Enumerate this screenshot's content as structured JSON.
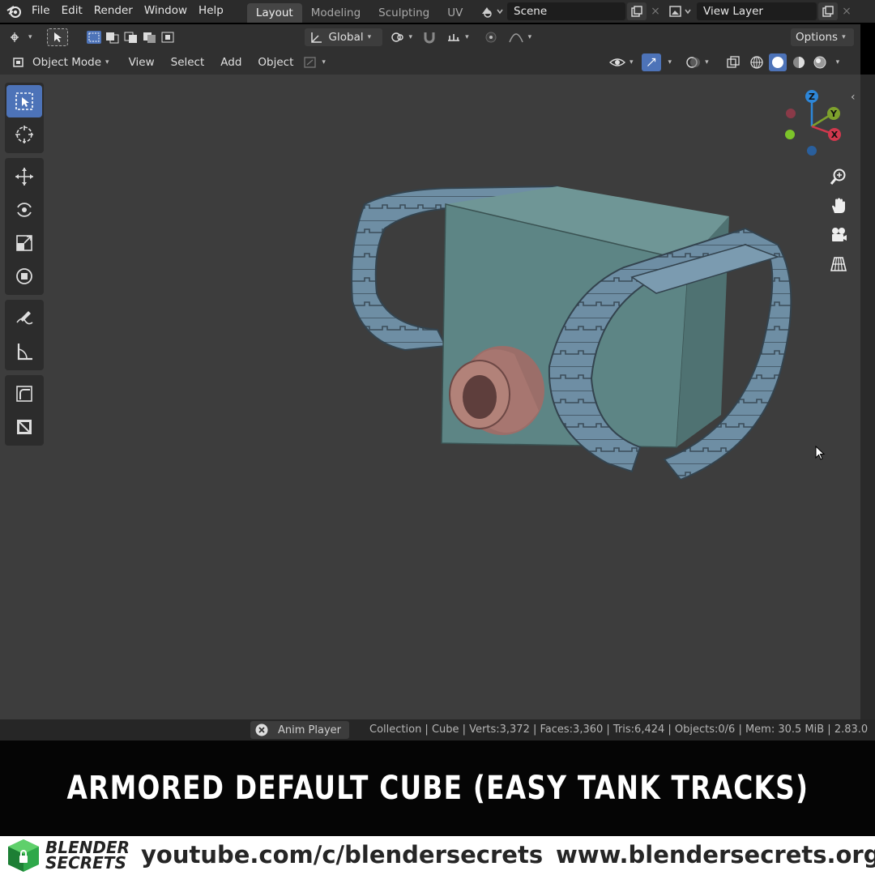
{
  "topbar": {
    "menus": [
      "File",
      "Edit",
      "Render",
      "Window",
      "Help"
    ],
    "workspaces": [
      {
        "label": "Layout",
        "active": true
      },
      {
        "label": "Modeling",
        "active": false
      },
      {
        "label": "Sculpting",
        "active": false
      },
      {
        "label": "UV",
        "active": false
      }
    ],
    "scene": "Scene",
    "view_layer": "View Layer"
  },
  "tool_header": {
    "transform_orientation": "Global",
    "options_label": "Options"
  },
  "viewport_header": {
    "mode": "Object Mode",
    "menus": [
      "View",
      "Select",
      "Add",
      "Object"
    ]
  },
  "gizmo": {
    "z_label": "Z",
    "y_label": "Y",
    "x_label": "X"
  },
  "statusbar": {
    "anim_player": "Anim Player",
    "stats": "Collection | Cube | Verts:3,372 | Faces:3,360 | Tris:6,424 | Objects:0/6 | Mem: 30.5 MiB | 2.83.0"
  },
  "caption": "ARMORED DEFAULT CUBE (EASY TANK TRACKS)",
  "footer": {
    "brand_line1": "BLENDER",
    "brand_line2": "SECRETS",
    "youtube_url": "youtube.com/c/blendersecrets",
    "website_url": "www.blendersecrets.org"
  },
  "colors": {
    "viewport_bg": "#3d3d3d",
    "header_bg": "#303030",
    "active_tool": "#4d73b8",
    "cube": "#5f8585",
    "tracks": "#6f8fa5",
    "barrel": "#a77670",
    "brand_green": "#2ea84a"
  }
}
